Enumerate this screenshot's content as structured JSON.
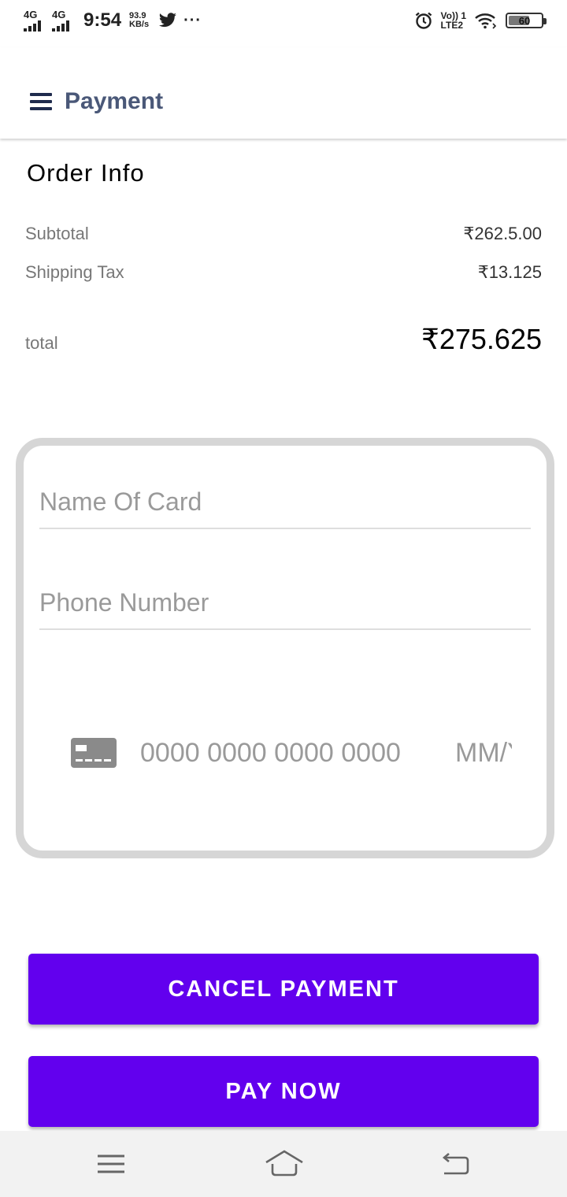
{
  "status_bar": {
    "network_1": "4G",
    "network_2": "4G",
    "time": "9:54",
    "speed_value": "93.9",
    "speed_unit": "KB/s",
    "more": "···",
    "volte_top": "Vo)) 1",
    "volte_bottom": "LTE2",
    "battery": "60"
  },
  "app_bar": {
    "title": "Payment"
  },
  "order_info": {
    "title": "Order Info",
    "subtotal_label": "Subtotal",
    "subtotal_value": "₹262.5.00",
    "shipping_label": "Shipping Tax",
    "shipping_value": "₹13.125",
    "total_label": "total",
    "total_value": "₹275.625"
  },
  "card_form": {
    "name_placeholder": "Name Of Card",
    "phone_placeholder": "Phone Number",
    "card_number_placeholder": "0000 0000 0000 0000",
    "expiry_placeholder": "MM/YY"
  },
  "buttons": {
    "cancel_label": "CANCEL PAYMENT",
    "pay_label": "PAY NOW",
    "color": "#6200ee"
  },
  "icons": {
    "menu": "hamburger-menu-icon",
    "card": "credit-card-icon",
    "nav_menu": "nav-menu-icon",
    "nav_home": "nav-home-icon",
    "nav_back": "nav-back-icon"
  }
}
